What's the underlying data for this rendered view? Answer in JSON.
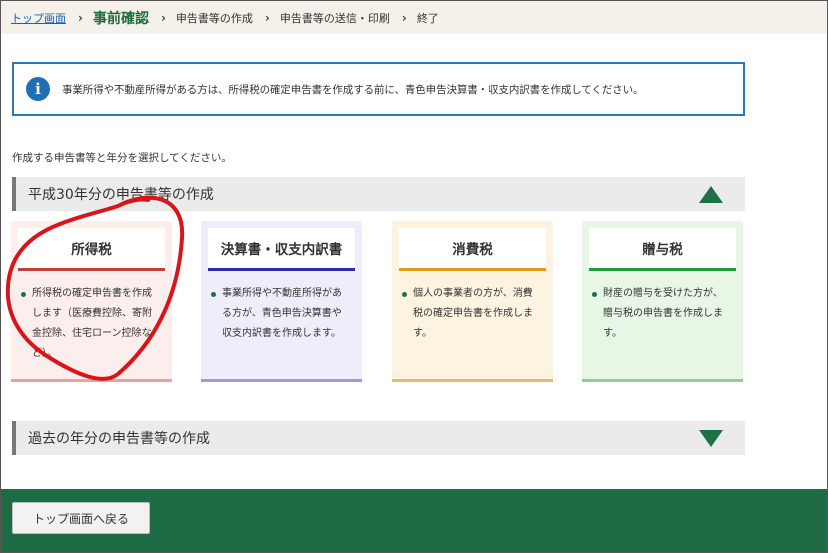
{
  "breadcrumb": {
    "home": "トップ画面",
    "current": "事前確認",
    "steps": [
      "申告書等の作成",
      "申告書等の送信・印刷",
      "終了"
    ],
    "separator": "›"
  },
  "info": {
    "icon": "info-icon",
    "icon_glyph": "i",
    "text": "事業所得や不動産所得がある方は、所得税の確定申告書を作成する前に、青色申告決算書・収支内訳書を作成してください。"
  },
  "instruction": "作成する申告書等と年分を選択してください。",
  "current_section": {
    "title": "平成30年分の申告書等の作成",
    "toggle_icon": "triangle-up-icon",
    "cards": [
      {
        "title": "所得税",
        "lines": [
          "所得税の確定申告書を作成",
          "します（医療費控除、寄附",
          "金控除、住宅ローン控除な",
          "ど）。"
        ]
      },
      {
        "title": "決算書・収支内訳書",
        "lines": [
          "事業所得や不動産所得があ",
          "る方が、青色申告決算書や",
          "収支内訳書を作成します。"
        ]
      },
      {
        "title": "消費税",
        "lines": [
          "個人の事業者の方が、消費",
          "税の確定申告書を作成しま",
          "す。"
        ]
      },
      {
        "title": "贈与税",
        "lines": [
          "財産の贈与を受けた方が、",
          "贈与税の申告書を作成しま",
          "す。"
        ]
      }
    ]
  },
  "past_section": {
    "title": "過去の年分の申告書等の作成",
    "toggle_icon": "triangle-down-icon"
  },
  "footer": {
    "back_label": "トップ画面へ戻る"
  },
  "colors": {
    "brand_green": "#1e6b45",
    "info_blue": "#2a79b8",
    "annotation_red": "#d8151b"
  }
}
